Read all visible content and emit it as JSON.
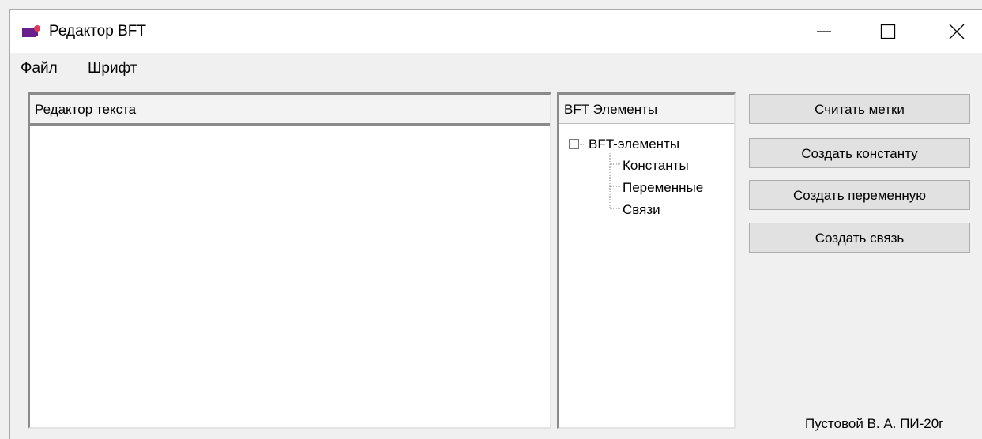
{
  "window": {
    "title": "Редактор BFT",
    "icon": "app-icon",
    "controls": [
      "minimize-icon",
      "maximize-icon",
      "close-icon"
    ]
  },
  "menu": [
    "Файл",
    "Шрифт"
  ],
  "editor": {
    "header": "Редактор текста",
    "content": ""
  },
  "tree": {
    "header": "BFT Элементы",
    "root": "BFT-элементы",
    "root_expanded": true,
    "children": [
      "Константы",
      "Переменные",
      "Связи"
    ]
  },
  "buttons": [
    "Считать метки",
    "Создать константу",
    "Создать переменную",
    "Создать связь"
  ],
  "author": "Пустовой В. А. ПИ-20г",
  "colors": {
    "icon_purple": "#6b1f8c",
    "icon_red": "#e03a5a"
  }
}
